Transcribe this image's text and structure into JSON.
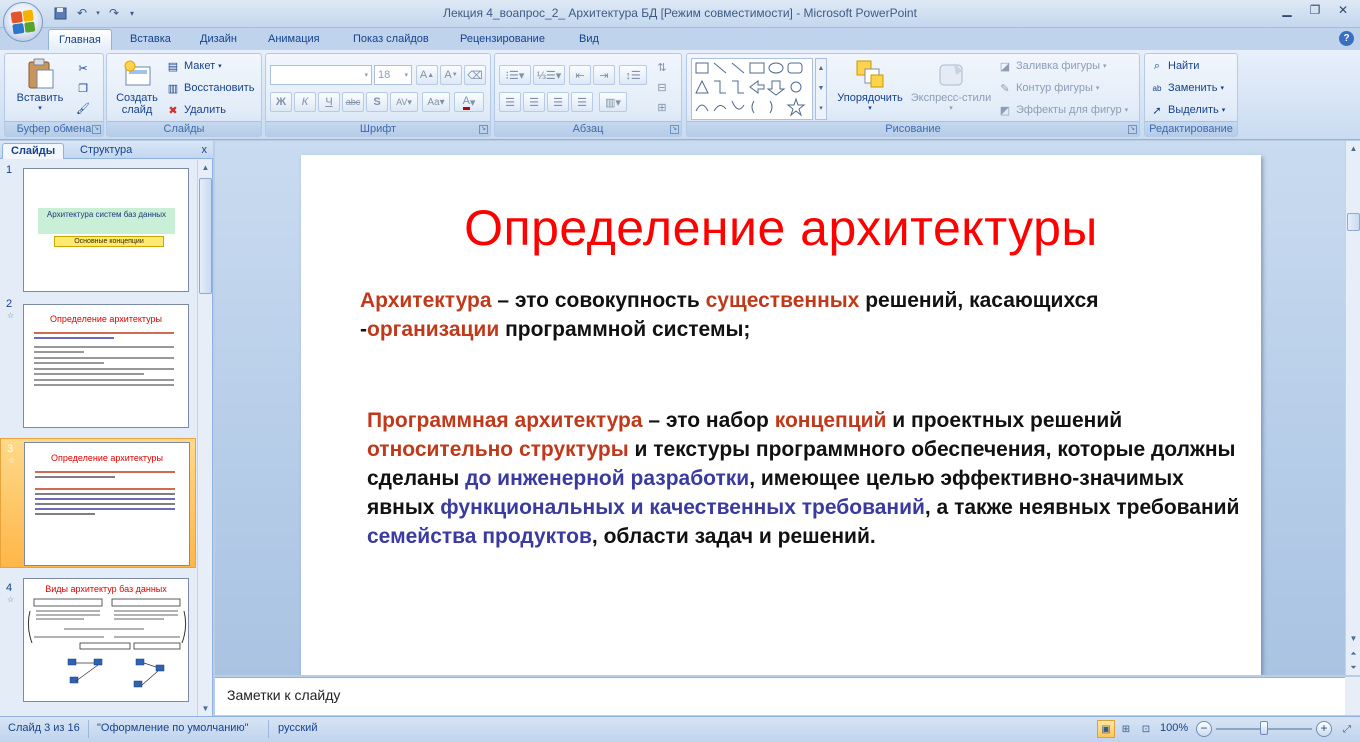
{
  "window": {
    "title": "Лекция 4_воапрос_2_ Архитектура БД  [Режим совместимости] - Microsoft PowerPoint"
  },
  "tabs": [
    "Главная",
    "Вставка",
    "Дизайн",
    "Анимация",
    "Показ слайдов",
    "Рецензирование",
    "Вид"
  ],
  "ribbon": {
    "clipboard": {
      "label": "Буфер обмена",
      "paste": "Вставить"
    },
    "slides": {
      "label": "Слайды",
      "new_slide_line1": "Создать",
      "new_slide_line2": "слайд",
      "layout": "Макет",
      "reset": "Восстановить",
      "delete": "Удалить"
    },
    "font": {
      "label": "Шрифт",
      "font_name": "",
      "font_size": "18"
    },
    "paragraph": {
      "label": "Абзац"
    },
    "drawing": {
      "label": "Рисование",
      "arrange": "Упорядочить",
      "quick_styles": "Экспресс-стили",
      "fill": "Заливка фигуры",
      "outline": "Контур фигуры",
      "effects": "Эффекты для фигур"
    },
    "editing": {
      "label": "Редактирование",
      "find": "Найти",
      "replace": "Заменить",
      "select": "Выделить"
    }
  },
  "left_pane": {
    "tab_slides": "Слайды",
    "tab_outline": "Структура",
    "close": "x",
    "thumbnails": [
      {
        "num": "1",
        "title": "Архитектура систем баз данных",
        "subtitle": "Основные концепции"
      },
      {
        "num": "2",
        "title": "Определение архитектуры"
      },
      {
        "num": "3",
        "title": "Определение архитектуры"
      },
      {
        "num": "4",
        "title": "Виды архитектур баз данных"
      }
    ]
  },
  "slide": {
    "title": "Определение  архитектуры",
    "p1": {
      "t1": "Архитектура",
      "t2": " – это совокупность ",
      "t3": "существенных",
      "t4": " решений, касающихся -",
      "t5": "организации",
      "t6": " программной системы;"
    },
    "p2": {
      "t1": "Программная архитектура",
      "t2": " – это набор ",
      "t3": "концепций",
      "t4": " и проектных решений ",
      "t5": "относительно структуры",
      "t6": " и текстуры программного обеспечения, которые должны сделаны ",
      "t7": "до инженерной разработки",
      "t8": ", имеющее целью эффективно-значимых явных ",
      "t9": "функциональных и качественных требований",
      "t10": ", а также неявных требований ",
      "t11": "семейства продуктов",
      "t12": ", области задач и решений."
    }
  },
  "notes": {
    "placeholder": "Заметки к слайду"
  },
  "status": {
    "slide_info": "Слайд 3 из 16",
    "theme": "\"Оформление по умолчанию\"",
    "language": "русский",
    "zoom": "100%"
  }
}
